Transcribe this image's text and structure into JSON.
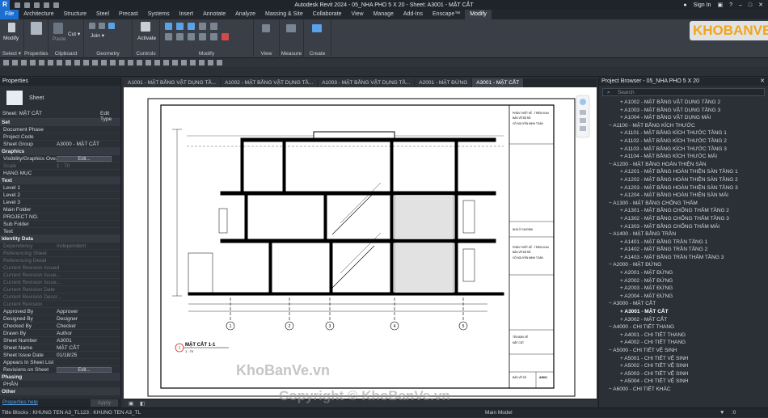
{
  "app": {
    "title": "Autodesk Revit 2024 - 05_NHA PHO 5 X 20 - Sheet: A3001 - MẶT CẮT",
    "sign_in": "Sign In",
    "logo": "R"
  },
  "ribbon_tabs": [
    "File",
    "Architecture",
    "Structure",
    "Steel",
    "Precast",
    "Systems",
    "Insert",
    "Annotate",
    "Analyze",
    "Massing & Site",
    "Collaborate",
    "View",
    "Manage",
    "Add-Ins",
    "Enscape™",
    "Modify"
  ],
  "ribbon": {
    "modify": "Modify",
    "select": "Select ▾",
    "properties": "Properties",
    "clipboard": "Clipboard",
    "paste": "Paste",
    "cut": "Cut ▾",
    "join": "Join ▾",
    "geometry": "Geometry",
    "activate": "Activate",
    "controls": "Controls",
    "modify_group": "Modify",
    "view": "View",
    "measure": "Measure",
    "create": "Create"
  },
  "properties": {
    "title": "Properties",
    "type_name": "Sheet",
    "selector": "Sheet: MẶT CẮT",
    "edit_type": "Edit Type",
    "rows": [
      {
        "kind": "cat",
        "label": "Set"
      },
      {
        "label": "Document Phase",
        "value": ""
      },
      {
        "label": "Project Code",
        "value": ""
      },
      {
        "label": "Sheet Group",
        "value": "A3000 - MẶT CẮT"
      },
      {
        "kind": "cat",
        "label": "Graphics"
      },
      {
        "label": "Visibility/Graphics Ove...",
        "button": "Edit..."
      },
      {
        "label": "Scale",
        "value": "1 : 70",
        "dim": true
      },
      {
        "label": "HẠNG MỤC",
        "value": ""
      },
      {
        "kind": "cat",
        "label": "Text"
      },
      {
        "label": "Level 1",
        "value": ""
      },
      {
        "label": "Level 2",
        "value": ""
      },
      {
        "label": "Level 3",
        "value": ""
      },
      {
        "label": "Main Folder",
        "value": ""
      },
      {
        "label": "PROJECT NO.",
        "value": ""
      },
      {
        "label": "Sub Folder",
        "value": ""
      },
      {
        "label": "Text",
        "value": ""
      },
      {
        "kind": "cat",
        "label": "Identity Data"
      },
      {
        "label": "Dependency",
        "value": "Independent",
        "dim": true
      },
      {
        "label": "Referencing Sheet",
        "value": "",
        "dim": true
      },
      {
        "label": "Referencing Detail",
        "value": "",
        "dim": true
      },
      {
        "label": "Current Revision Issued",
        "value": "",
        "dim": true
      },
      {
        "label": "Current Revision Issue...",
        "value": "",
        "dim": true
      },
      {
        "label": "Current Revision Issue...",
        "value": "",
        "dim": true
      },
      {
        "label": "Current Revision Date",
        "value": "",
        "dim": true
      },
      {
        "label": "Current Revision Descr...",
        "value": "",
        "dim": true
      },
      {
        "label": "Current Revision",
        "value": "",
        "dim": true
      },
      {
        "label": "Approved By",
        "value": "Approver"
      },
      {
        "label": "Designed By",
        "value": "Designer"
      },
      {
        "label": "Checked By",
        "value": "Checker"
      },
      {
        "label": "Drawn By",
        "value": "Author"
      },
      {
        "label": "Sheet Number",
        "value": "A3001"
      },
      {
        "label": "Sheet Name",
        "value": "MẶT CẮT"
      },
      {
        "label": "Sheet Issue Date",
        "value": "01/18/25"
      },
      {
        "label": "Appears In Sheet List",
        "value": ""
      },
      {
        "label": "Revisions on Sheet",
        "button": "Edit..."
      },
      {
        "kind": "cat",
        "label": "Phasing"
      },
      {
        "label": "PHÂN",
        "value": ""
      },
      {
        "kind": "cat",
        "label": "Other"
      }
    ],
    "help": "Properties help",
    "apply": "Apply"
  },
  "view_tabs": [
    "A1001 - MẶT BẰNG VẬT DỤNG TẦ...",
    "A1002 - MẶT BẰNG VẬT DỤNG TẦ...",
    "A1003 - MẶT BẰNG VẬT DỤNG TẦ...",
    "A2001 - MẶT ĐỨNG",
    "A3001 - MẶT CẮT"
  ],
  "drawing": {
    "section_no": "1",
    "section_title": "MẶT CẮT 1-1",
    "section_scale": "1 : 70",
    "axes": [
      "1",
      "2",
      "3",
      "4",
      "5"
    ],
    "tb": {
      "l1": "PHẦN THIẾT KẾ - TRIỂN KHAI",
      "l2": "BẢN VẼ ĐÃ RÃ",
      "l3": "VÕ NGUYỄN MINH TOÀN",
      "l4": "NHÀ Ở GIA ĐÌNH",
      "l5": "PHẦN THIẾT KẾ - TRIỂN KHAI",
      "l6": "BẢN VẼ ĐÃ RÃ",
      "l7": "VÕ NGUYỄN MINH TOÀN",
      "l8": "TÊN BẢN VẼ",
      "l9": "MẶT CẮT",
      "l10": "BẢN VẼ SỐ",
      "l11": "A3001"
    }
  },
  "browser": {
    "title": "Project Browser - 05_NHA PHO 5 X 20",
    "search_placeholder": "Search",
    "items": [
      {
        "t": "leaf",
        "label": "A1002 - MẶT BẰNG VẬT DỤNG TẦNG 2"
      },
      {
        "t": "leaf",
        "label": "A1003 - MẶT BẰNG VẬT DỤNG TẦNG 3"
      },
      {
        "t": "leaf",
        "label": "A1004 - MẶT BẰNG VẬT DỤNG MÁI"
      },
      {
        "t": "group",
        "label": "A1100 - MẶT BẰNG KÍCH THƯỚC"
      },
      {
        "t": "leaf",
        "label": "A1101 - MẶT BẰNG KÍCH THƯỚC TẦNG 1"
      },
      {
        "t": "leaf",
        "label": "A1102 - MẶT BẰNG KÍCH THƯỚC TẦNG 2"
      },
      {
        "t": "leaf",
        "label": "A1103 - MẶT BẰNG KÍCH THƯỚC TẦNG 3"
      },
      {
        "t": "leaf",
        "label": "A1104 - MẶT BẰNG KÍCH THƯỚC MÁI"
      },
      {
        "t": "group",
        "label": "A1200 - MẶT BẰNG HOÀN THIỆN SÀN"
      },
      {
        "t": "leaf",
        "label": "A1201 - MẶT BẰNG HOÀN THIỆN SÀN TẦNG 1"
      },
      {
        "t": "leaf",
        "label": "A1202 - MẶT BẰNG HOÀN THIỆN SÀN TẦNG 2"
      },
      {
        "t": "leaf",
        "label": "A1203 - MẶT BẰNG HOÀN THIỆN SÀN TẦNG 3"
      },
      {
        "t": "leaf",
        "label": "A1204 - MẶT BẰNG HOÀN THIỆN SÀN MÁI"
      },
      {
        "t": "group",
        "label": "A1300 - MẶT BẰNG CHỐNG THẤM"
      },
      {
        "t": "leaf",
        "label": "A1301 - MẶT BẰNG CHỐNG THẤM TẦNG 2"
      },
      {
        "t": "leaf",
        "label": "A1302 - MẶT BẰNG CHỐNG THẤM TẦNG 3"
      },
      {
        "t": "leaf",
        "label": "A1303 - MẶT BẰNG CHỐNG THẤM MÁI"
      },
      {
        "t": "group",
        "label": "A1400 - MẶT BẰNG TRẦN"
      },
      {
        "t": "leaf",
        "label": "A1401 - MẶT BẰNG TRẦN TẦNG 1"
      },
      {
        "t": "leaf",
        "label": "A1402 - MẶT BẰNG TRẦN TẦNG 2"
      },
      {
        "t": "leaf",
        "label": "A1403 - MẶT BẰNG TRẦN THẤM TẦNG 3"
      },
      {
        "t": "group",
        "label": "A2000 - MẶT ĐỨNG"
      },
      {
        "t": "leaf",
        "label": "A2001 - MẶT ĐỨNG"
      },
      {
        "t": "leaf",
        "label": "A2002 - MẶT ĐỨNG"
      },
      {
        "t": "leaf",
        "label": "A2003 - MẶT ĐỨNG"
      },
      {
        "t": "leaf",
        "label": "A2004 - MẶT ĐỨNG"
      },
      {
        "t": "group",
        "label": "A3000 - MẶT CẮT"
      },
      {
        "t": "leaf",
        "label": "A3001 - MẶT CẮT",
        "sel": true
      },
      {
        "t": "leaf",
        "label": "A3002 - MẶT CẮT"
      },
      {
        "t": "group",
        "label": "A4000 - CHI TIẾT THANG"
      },
      {
        "t": "leaf",
        "label": "A4001 - CHI TIẾT THANG"
      },
      {
        "t": "leaf",
        "label": "A4002 - CHI TIẾT THANG"
      },
      {
        "t": "group",
        "label": "A5000 - CHI TIẾT VỆ SINH"
      },
      {
        "t": "leaf",
        "label": "A5001 - CHI TIẾT VỆ SINH"
      },
      {
        "t": "leaf",
        "label": "A5002 - CHI TIẾT VỆ SINH"
      },
      {
        "t": "leaf",
        "label": "A5003 - CHI TIẾT VỆ SINH"
      },
      {
        "t": "leaf",
        "label": "A5004 - CHI TIẾT VỆ SINH"
      },
      {
        "t": "group",
        "label": "A6000 - CHI TIẾT KHÁC"
      }
    ]
  },
  "status": {
    "text": "Title Blocks : KHUNG TEN A3_TL123 : KHUNG TEN A3_TL",
    "model": "Main Model",
    "zero": ":0"
  },
  "watermarks": {
    "logo": "KHOBANVE",
    "center": "KhoBanVe.vn",
    "copyright": "Copyright © KhoBanVe.vn"
  },
  "colors": {
    "accent": "#1c6fd1",
    "section_red": "#d42a2a",
    "logo_orange": "#f2a51a"
  }
}
